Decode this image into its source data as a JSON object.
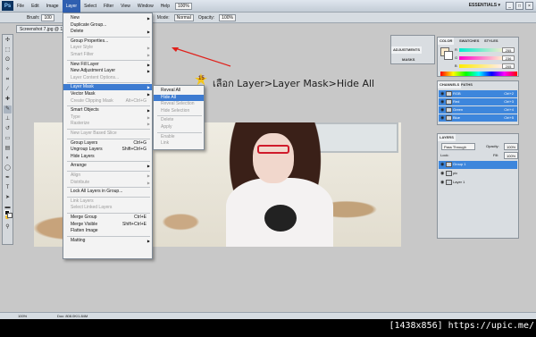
{
  "app": {
    "menus": [
      "File",
      "Edit",
      "Image",
      "Layer",
      "Select",
      "Filter",
      "View",
      "Window",
      "Help"
    ],
    "workspace": "ESSENTIALS ▾",
    "zoom": "100%"
  },
  "options_bar": {
    "brush_label": "Brush:",
    "brush_size": "100",
    "mode_label": "Mode:",
    "mode_value": "Normal",
    "opacity_label": "Opacity:",
    "opacity_value": "100%"
  },
  "document": {
    "tab_title": "Screenshot 7.jpg @ 1..."
  },
  "layer_menu": {
    "items": [
      {
        "label": "New",
        "arrow": true,
        "disabled": false
      },
      {
        "label": "Duplicate Group...",
        "disabled": false
      },
      {
        "label": "Delete",
        "arrow": true,
        "disabled": false
      },
      {
        "sep": true
      },
      {
        "label": "Group Properties...",
        "disabled": false
      },
      {
        "label": "Layer Style",
        "arrow": true,
        "disabled": true
      },
      {
        "label": "Smart Filter",
        "arrow": true,
        "disabled": true
      },
      {
        "sep": true
      },
      {
        "label": "New Fill Layer",
        "arrow": true,
        "disabled": false
      },
      {
        "label": "New Adjustment Layer",
        "arrow": true,
        "disabled": false
      },
      {
        "label": "Layer Content Options...",
        "disabled": true
      },
      {
        "sep": true
      },
      {
        "label": "Layer Mask",
        "arrow": true,
        "disabled": false,
        "highlighted": true
      },
      {
        "label": "Vector Mask",
        "arrow": true,
        "disabled": false
      },
      {
        "label": "Create Clipping Mask",
        "shortcut": "Alt+Ctrl+G",
        "disabled": true
      },
      {
        "sep": true
      },
      {
        "label": "Smart Objects",
        "arrow": true,
        "disabled": false
      },
      {
        "label": "Type",
        "arrow": true,
        "disabled": true
      },
      {
        "label": "Rasterize",
        "arrow": true,
        "disabled": true
      },
      {
        "sep": true
      },
      {
        "label": "New Layer Based Slice",
        "disabled": true
      },
      {
        "sep": true
      },
      {
        "label": "Group Layers",
        "shortcut": "Ctrl+G",
        "disabled": false
      },
      {
        "label": "Ungroup Layers",
        "shortcut": "Shift+Ctrl+G",
        "disabled": false
      },
      {
        "label": "Hide Layers",
        "disabled": false
      },
      {
        "sep": true
      },
      {
        "label": "Arrange",
        "arrow": true,
        "disabled": false
      },
      {
        "sep": true
      },
      {
        "label": "Align",
        "arrow": true,
        "disabled": true
      },
      {
        "label": "Distribute",
        "arrow": true,
        "disabled": true
      },
      {
        "sep": true
      },
      {
        "label": "Lock All Layers in Group...",
        "disabled": false
      },
      {
        "sep": true
      },
      {
        "label": "Link Layers",
        "disabled": true
      },
      {
        "label": "Select Linked Layers",
        "disabled": true
      },
      {
        "sep": true
      },
      {
        "label": "Merge Group",
        "shortcut": "Ctrl+E",
        "disabled": false
      },
      {
        "label": "Merge Visible",
        "shortcut": "Shift+Ctrl+E",
        "disabled": false
      },
      {
        "label": "Flatten Image",
        "disabled": false
      },
      {
        "sep": true
      },
      {
        "label": "Matting",
        "arrow": true,
        "disabled": false
      }
    ]
  },
  "layer_mask_submenu": {
    "items": [
      {
        "label": "Reveal All",
        "disabled": false
      },
      {
        "label": "Hide All",
        "disabled": false,
        "highlighted": true
      },
      {
        "label": "Reveal Selection",
        "disabled": true
      },
      {
        "label": "Hide Selection",
        "disabled": true
      },
      {
        "sep": true
      },
      {
        "label": "Delete",
        "disabled": true
      },
      {
        "label": "Apply",
        "disabled": true
      },
      {
        "sep": true
      },
      {
        "label": "Enable",
        "disabled": true
      },
      {
        "label": "Link",
        "disabled": true
      }
    ]
  },
  "instruction": {
    "step": "15",
    "text": "เลือก Layer>Layer Mask>Hide All"
  },
  "adjust_panel": {
    "tabs": [
      "ADJUSTMENTS",
      "MASKS"
    ]
  },
  "color_panel": {
    "tabs": [
      "COLOR",
      "SWATCHES",
      "STYLES"
    ],
    "values": [
      "255",
      "236",
      "205"
    ],
    "letters": [
      "R",
      "G",
      "B"
    ]
  },
  "channels_panel": {
    "tabs": [
      "CHANNELS",
      "PATHS"
    ],
    "rows": [
      {
        "name": "RGB",
        "shortcut": "Ctrl+2"
      },
      {
        "name": "Red",
        "shortcut": "Ctrl+3"
      },
      {
        "name": "Green",
        "shortcut": "Ctrl+4"
      },
      {
        "name": "Blue",
        "shortcut": "Ctrl+5"
      }
    ]
  },
  "layers_panel": {
    "tab": "LAYERS",
    "blend_mode": "Pass Through",
    "opacity_label": "Opacity:",
    "opacity_value": "100%",
    "lock_label": "Lock:",
    "fill_label": "Fill:",
    "fill_value": "100%",
    "rows": [
      {
        "name": "Group 1",
        "selected": true
      },
      {
        "name": "pic",
        "selected": false
      },
      {
        "name": "Layer 1",
        "selected": false
      }
    ]
  },
  "status_bar": {
    "zoom": "100%",
    "doc": "Doc: 808.0K/1.84M"
  },
  "watermark": "[1438x856] https://upic.me/"
}
